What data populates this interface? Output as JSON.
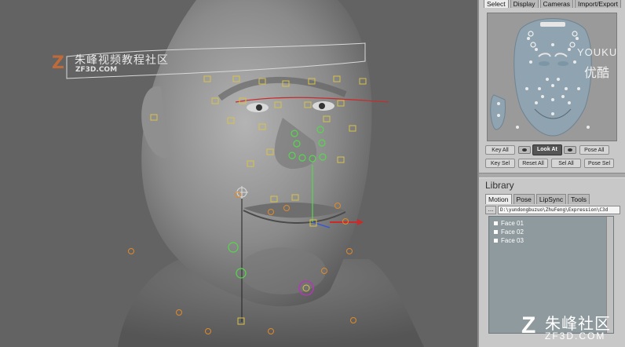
{
  "watermark": {
    "cn": "朱峰视频教程社区",
    "en": "ZF3D.COM",
    "logo": "Z"
  },
  "panel": {
    "top_tabs": [
      "Select",
      "Display",
      "Cameras",
      "Import/Export"
    ],
    "top_tab_active": "Select",
    "youku": {
      "line1": "YOUKU",
      "line2": "优酷"
    },
    "buttons_row1": {
      "key_all": "Key All",
      "look_at": "Look At",
      "pose_all": "Pose All"
    },
    "buttons_row2": [
      "Key Sel",
      "Reset All",
      "Sel All",
      "Pose Sel"
    ],
    "library": {
      "title": "Library",
      "tabs": [
        "Motion",
        "Pose",
        "LipSync",
        "Tools"
      ],
      "tab_active": "Motion",
      "path_button": "...",
      "path_value": "D:\\yundongbuzuo\\ZhuFeng\\Expression\\C3d",
      "items": [
        "Face 01",
        "Face 02",
        "Face 03"
      ]
    }
  },
  "corner_watermark": {
    "logo": "Z",
    "cn": "朱峰社区",
    "en": "ZF3D.COM"
  },
  "colors": {
    "accent_red": "#cc2a2a",
    "control_yellow": "#d8c24a",
    "control_green": "#55d84a",
    "control_orange": "#e08a2a",
    "control_magenta": "#b23ab2"
  }
}
